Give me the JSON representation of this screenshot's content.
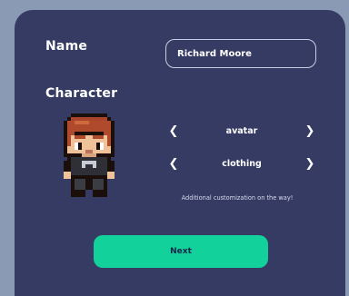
{
  "form": {
    "name_label": "Name",
    "name_value": "Richard Moore",
    "character_label": "Character"
  },
  "selectors": {
    "avatar": {
      "label": "avatar",
      "prev_icon": "chevron-left-icon",
      "next_icon": "chevron-right-icon"
    },
    "clothing": {
      "label": "clothing",
      "prev_icon": "chevron-left-icon",
      "next_icon": "chevron-right-icon"
    }
  },
  "note": "Additional customization on the way!",
  "next_button": {
    "label": "Next"
  },
  "colors": {
    "page_bg": "#8a9ab5",
    "panel_bg": "#353b63",
    "accent": "#12d19a",
    "text": "#ffffff"
  }
}
